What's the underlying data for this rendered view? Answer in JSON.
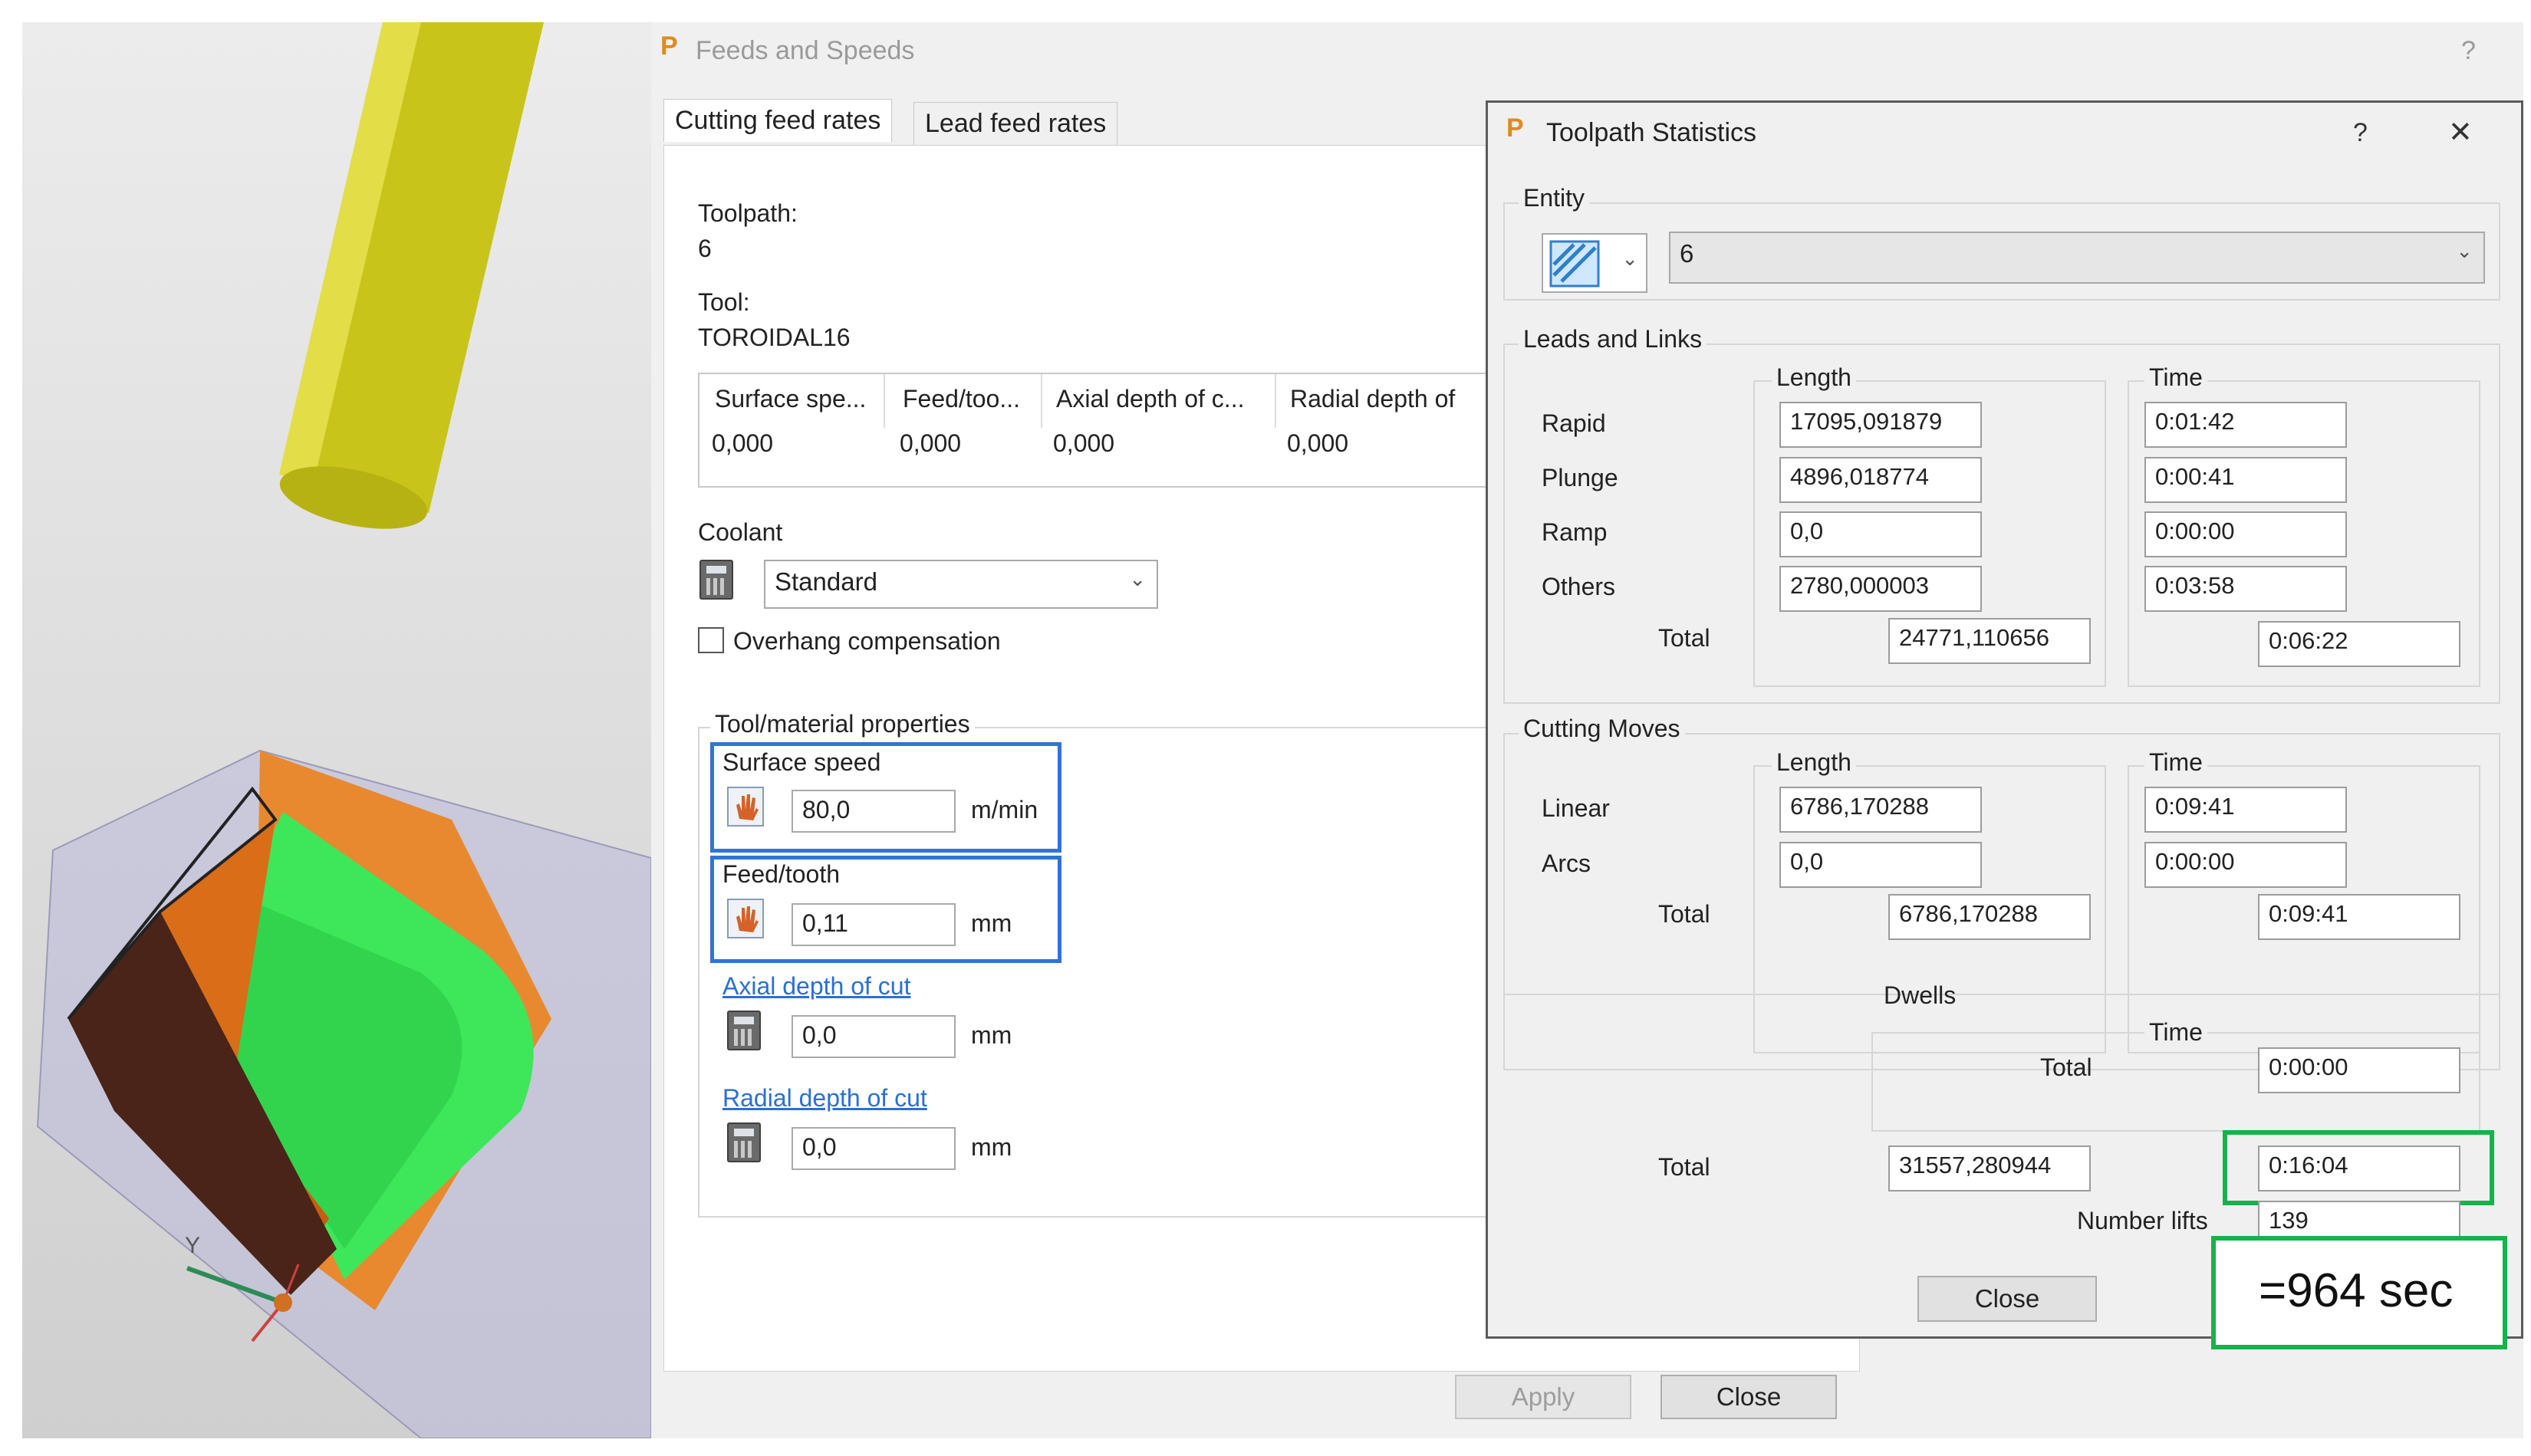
{
  "feeds_dialog": {
    "title": "Feeds and Speeds",
    "help": "?",
    "tabs": [
      {
        "label": "Cutting feed rates"
      },
      {
        "label": "Lead feed rates"
      }
    ],
    "toolpath_label": "Toolpath:",
    "toolpath_value": "6",
    "tool_label": "Tool:",
    "tool_value": "TOROIDAL16",
    "grid": {
      "headers": [
        "Surface spe...",
        "Feed/too...",
        "Axial depth of c...",
        "Radial depth of"
      ],
      "values": [
        "0,000",
        "0,000",
        "0,000",
        "0,000"
      ]
    },
    "coolant_label": "Coolant",
    "coolant_value": "Standard",
    "overhang_label": "Overhang compensation",
    "overhang_checked": false,
    "tool_material_label": "Tool/material properties",
    "surface_speed": {
      "label": "Surface speed",
      "value": "80,0",
      "unit": "m/min"
    },
    "feed_tooth": {
      "label": "Feed/tooth",
      "value": "0,11",
      "unit": "mm"
    },
    "axial_depth": {
      "label": "Axial depth of cut",
      "value": "0,0",
      "unit": "mm"
    },
    "radial_depth": {
      "label": "Radial depth of cut",
      "value": "0,0",
      "unit": "mm"
    },
    "apply_label": "Apply",
    "close_label": "Close"
  },
  "stats_dialog": {
    "title": "Toolpath Statistics",
    "help": "?",
    "close_x": "✕",
    "entity_label": "Entity",
    "entity_value": "6",
    "leads_links": {
      "title": "Leads and Links",
      "length_header": "Length",
      "time_header": "Time",
      "rows": [
        {
          "label": "Rapid",
          "length": "17095,091879",
          "time": "0:01:42"
        },
        {
          "label": "Plunge",
          "length": "4896,018774",
          "time": "0:00:41"
        },
        {
          "label": "Ramp",
          "length": "0,0",
          "time": "0:00:00"
        },
        {
          "label": "Others",
          "length": "2780,000003",
          "time": "0:03:58"
        }
      ],
      "total_label": "Total",
      "total_length": "24771,110656",
      "total_time": "0:06:22"
    },
    "cutting_moves": {
      "title": "Cutting Moves",
      "length_header": "Length",
      "time_header": "Time",
      "rows": [
        {
          "label": "Linear",
          "length": "6786,170288",
          "time": "0:09:41"
        },
        {
          "label": "Arcs",
          "length": "0,0",
          "time": "0:00:00"
        }
      ],
      "total_label": "Total",
      "total_length": "6786,170288",
      "total_time": "0:09:41"
    },
    "dwells": {
      "title": "Dwells",
      "time_header": "Time",
      "total_label": "Total",
      "total_time": "0:00:00"
    },
    "grand_total_label": "Total",
    "grand_total_length": "31557,280944",
    "grand_total_time": "0:16:04",
    "number_lifts_label": "Number lifts",
    "number_lifts_value": "139",
    "close_label": "Close"
  },
  "annotation": {
    "text": "=964 sec"
  },
  "viewport": {
    "axis_label": "Y"
  },
  "colors": {
    "highlight_blue": "#2e75d6",
    "highlight_green": "#16b24b",
    "tool_yellow": "#c9c41a",
    "toolpath_green": "#3ee65a",
    "stock_orange": "#e8892f"
  }
}
